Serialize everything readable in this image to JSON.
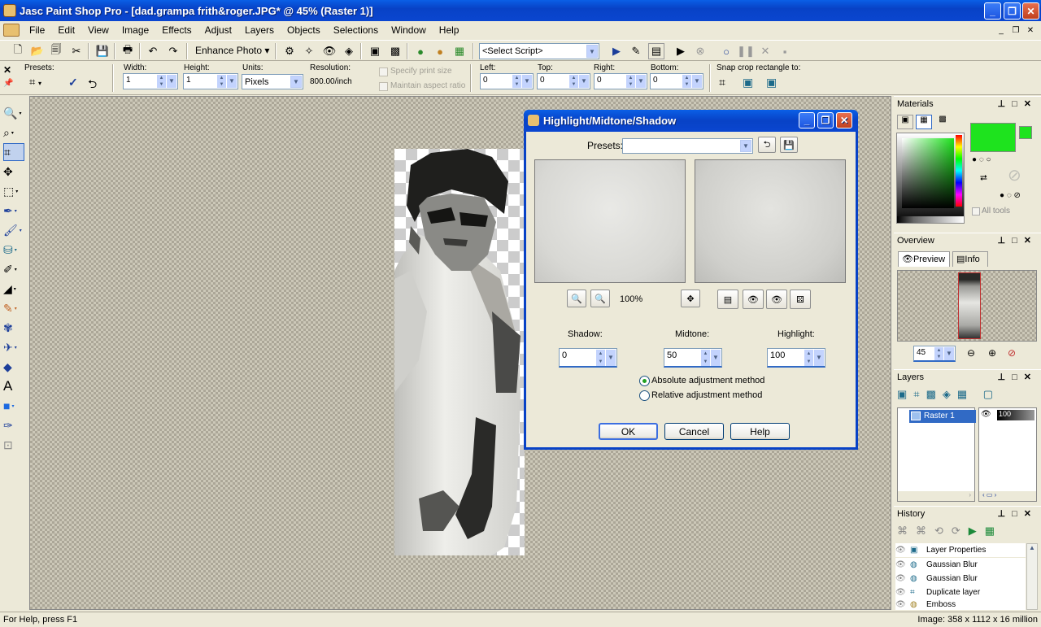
{
  "window": {
    "title": "Jasc Paint Shop Pro - [dad.grampa frith&roger.JPG* @  45% (Raster 1)]"
  },
  "menu": [
    "File",
    "Edit",
    "View",
    "Image",
    "Effects",
    "Adjust",
    "Layers",
    "Objects",
    "Selections",
    "Window",
    "Help"
  ],
  "toolbar": {
    "enhance_photo": "Enhance Photo",
    "script_select": "<Select Script>"
  },
  "crop_options": {
    "presets_label": "Presets:",
    "width_label": "Width:",
    "width_value": "1",
    "height_label": "Height:",
    "height_value": "1",
    "units_label": "Units:",
    "units_value": "Pixels",
    "resolution_label": "Resolution:",
    "resolution_value": "800.00/inch",
    "specify_print_size": "Specify print size",
    "maintain_aspect": "Maintain aspect ratio",
    "left_label": "Left:",
    "left_value": "0",
    "top_label": "Top:",
    "top_value": "0",
    "right_label": "Right:",
    "right_value": "0",
    "bottom_label": "Bottom:",
    "bottom_value": "0",
    "snap_label": "Snap crop rectangle to:"
  },
  "dialog": {
    "title": "Highlight/Midtone/Shadow",
    "presets_label": "Presets:",
    "presets_value": "",
    "zoom": "100%",
    "shadow_label": "Shadow:",
    "shadow_value": "0",
    "midtone_label": "Midtone:",
    "midtone_value": "50",
    "highlight_label": "Highlight:",
    "highlight_value": "100",
    "absolute_label": "Absolute adjustment method",
    "relative_label": "Relative adjustment method",
    "ok": "OK",
    "cancel": "Cancel",
    "help": "Help"
  },
  "materials": {
    "title": "Materials",
    "all_tools": "All tools",
    "fg_color": "#1ee31e"
  },
  "overview": {
    "title": "Overview",
    "tab_preview": "Preview",
    "tab_info": "Info",
    "zoom_value": "45"
  },
  "layers": {
    "title": "Layers",
    "layer_name": "Raster 1",
    "opacity": "100"
  },
  "history": {
    "title": "History",
    "items": [
      "Layer Properties",
      "Gaussian Blur",
      "Gaussian Blur",
      "Duplicate layer",
      "Emboss"
    ]
  },
  "status": {
    "help": "For Help, press F1",
    "image_info": "Image:  358 x 1112 x 16 million"
  }
}
